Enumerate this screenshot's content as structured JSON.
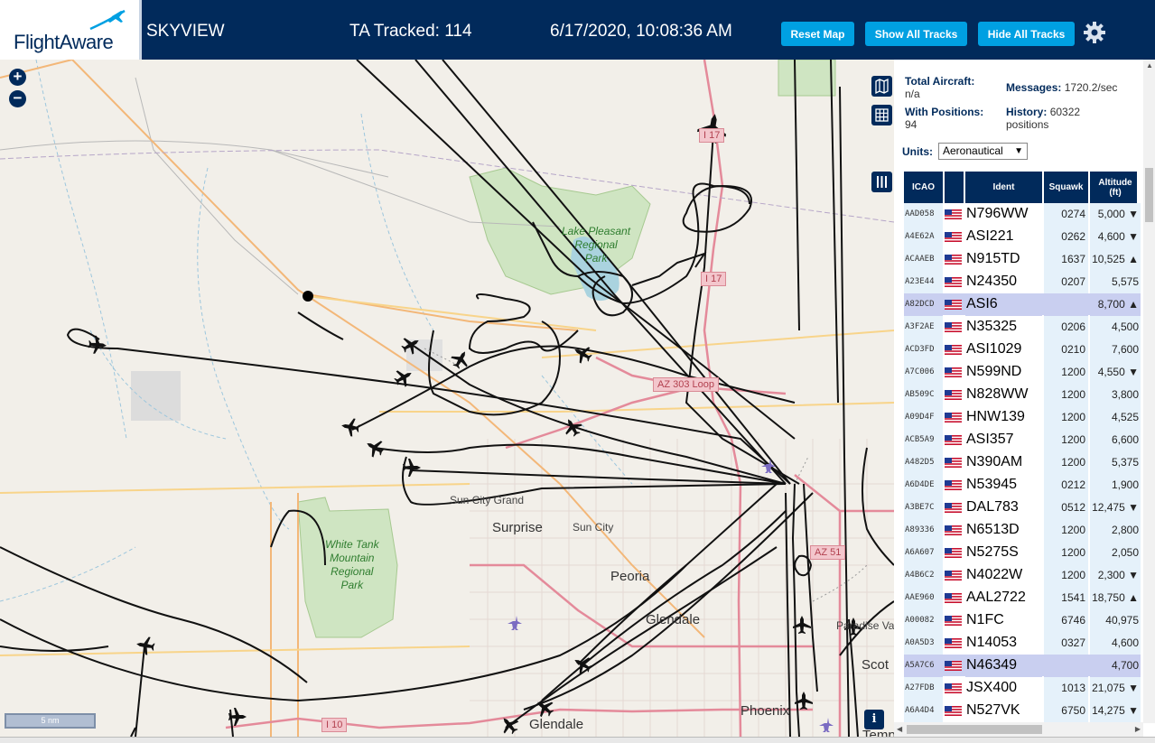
{
  "header": {
    "logo_text": "FlightAware",
    "app_name": "SKYVIEW",
    "tracked": "TA Tracked: 114",
    "datetime": "6/17/2020, 10:08:36 AM",
    "reset_map": "Reset Map",
    "show_all_tracks": "Show All Tracks",
    "hide_all_tracks": "Hide All Tracks",
    "bg_color": "#012a5b",
    "button_color": "#00a0e2"
  },
  "map": {
    "zoom_in": "+",
    "zoom_out": "−",
    "scale_label": "5 nm",
    "info_label": "i",
    "labels": {
      "lake_pleasant_1": "Lake Pleasant",
      "lake_pleasant_2": "Regional",
      "lake_pleasant_3": "Park",
      "white_tank_1": "White Tank",
      "white_tank_2": "Mountain",
      "white_tank_3": "Regional",
      "white_tank_4": "Park",
      "sun_city_grand": "Sun City Grand",
      "surprise": "Surprise",
      "sun_city": "Sun City",
      "peoria": "Peoria",
      "glendale": "Glendale",
      "glendale_2": "Glendale",
      "phoenix": "Phoenix",
      "paradise_valley": "Paradise Vale",
      "scottsdale": "Scot",
      "tempe": "Temp"
    },
    "highways": {
      "i17_top": "I 17",
      "i17_mid": "I 17",
      "az303": "AZ 303 Loop",
      "az51": "AZ 51",
      "i10": "I 10"
    }
  },
  "sidebar": {
    "total_aircraft_label": "Total Aircraft:",
    "total_aircraft_value": "n/a",
    "with_positions_label": "With Positions:",
    "with_positions_value": "94",
    "messages_label": "Messages:",
    "messages_value": "1720.2/sec",
    "history_label": "History:",
    "history_value": "60322",
    "history_unit": "positions",
    "units_label": "Units:",
    "units_value": "Aeronautical",
    "columns": {
      "icao": "ICAO",
      "ident": "Ident",
      "squawk": "Squawk",
      "altitude_1": "Altitude",
      "altitude_2": "(ft)"
    },
    "rows": [
      {
        "icao": "AAD058",
        "ident": "N796WW",
        "squawk": "0274",
        "altitude": "5,000 ▼"
      },
      {
        "icao": "A4E62A",
        "ident": "ASI221",
        "squawk": "0262",
        "altitude": "4,600 ▼"
      },
      {
        "icao": "ACAAEB",
        "ident": "N915TD",
        "squawk": "1637",
        "altitude": "10,525 ▲"
      },
      {
        "icao": "A23E44",
        "ident": "N24350",
        "squawk": "0207",
        "altitude": "5,575"
      },
      {
        "icao": "A82DCD",
        "ident": "ASI6",
        "squawk": "",
        "altitude": "8,700 ▲",
        "selected": true
      },
      {
        "icao": "A3F2AE",
        "ident": "N35325",
        "squawk": "0206",
        "altitude": "4,500"
      },
      {
        "icao": "ACD3FD",
        "ident": "ASI1029",
        "squawk": "0210",
        "altitude": "7,600"
      },
      {
        "icao": "A7C006",
        "ident": "N599ND",
        "squawk": "1200",
        "altitude": "4,550 ▼"
      },
      {
        "icao": "AB509C",
        "ident": "N828WW",
        "squawk": "1200",
        "altitude": "3,800"
      },
      {
        "icao": "A09D4F",
        "ident": "HNW139",
        "squawk": "1200",
        "altitude": "4,525"
      },
      {
        "icao": "ACB5A9",
        "ident": "ASI357",
        "squawk": "1200",
        "altitude": "6,600"
      },
      {
        "icao": "A482D5",
        "ident": "N390AM",
        "squawk": "1200",
        "altitude": "5,375"
      },
      {
        "icao": "A6D4DE",
        "ident": "N53945",
        "squawk": "0212",
        "altitude": "1,900"
      },
      {
        "icao": "A3BE7C",
        "ident": "DAL783",
        "squawk": "0512",
        "altitude": "12,475 ▼"
      },
      {
        "icao": "A89336",
        "ident": "N6513D",
        "squawk": "1200",
        "altitude": "2,800"
      },
      {
        "icao": "A6A607",
        "ident": "N5275S",
        "squawk": "1200",
        "altitude": "2,050"
      },
      {
        "icao": "A4B6C2",
        "ident": "N4022W",
        "squawk": "1200",
        "altitude": "2,300 ▼"
      },
      {
        "icao": "AAE960",
        "ident": "AAL2722",
        "squawk": "1541",
        "altitude": "18,750 ▲"
      },
      {
        "icao": "A00082",
        "ident": "N1FC",
        "squawk": "6746",
        "altitude": "40,975"
      },
      {
        "icao": "A0A5D3",
        "ident": "N14053",
        "squawk": "0327",
        "altitude": "4,600"
      },
      {
        "icao": "A5A7C6",
        "ident": "N46349",
        "squawk": "",
        "altitude": "4,700",
        "selected": true
      },
      {
        "icao": "A27FDB",
        "ident": "JSX400",
        "squawk": "1013",
        "altitude": "21,075 ▼"
      },
      {
        "icao": "A6A4D4",
        "ident": "N527VK",
        "squawk": "6750",
        "altitude": "14,275 ▼"
      }
    ]
  }
}
